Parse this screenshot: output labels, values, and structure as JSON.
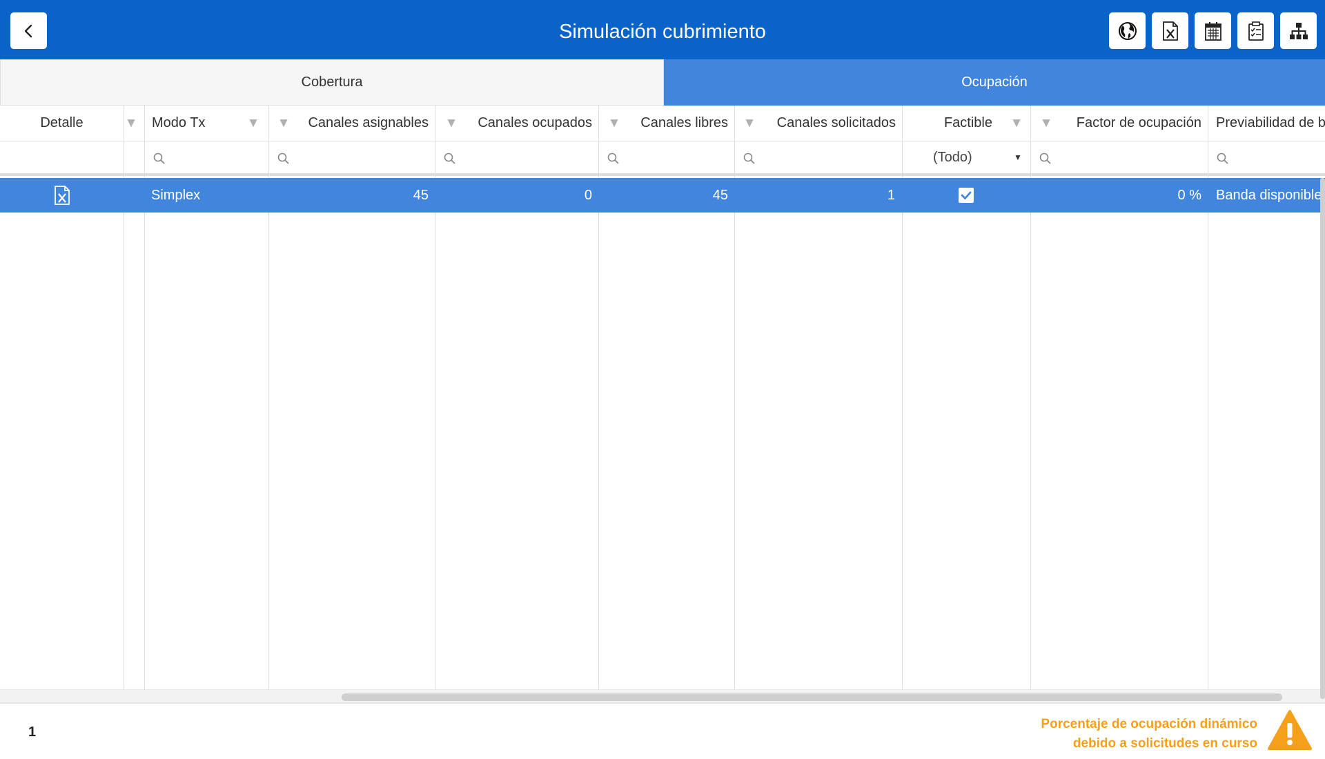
{
  "header": {
    "title": "Simulación cubrimiento",
    "back_icon": "chevron-left-icon",
    "tools": [
      "globe-icon",
      "excel-icon",
      "calendar-icon",
      "clipboard-icon",
      "org-chart-icon"
    ],
    "bg_color": "#0a63c9"
  },
  "tabs": [
    {
      "label": "Cobertura",
      "active": false
    },
    {
      "label": "Ocupación",
      "active": true
    }
  ],
  "grid": {
    "columns": [
      "Detalle",
      "Modo Tx",
      "Canales asignables",
      "Canales ocupados",
      "Canales libres",
      "Canales solicitados",
      "Factible",
      "Factor de ocupación",
      "Previabilidad de b"
    ],
    "factible_filter": "(Todo)",
    "rows": [
      {
        "detalle_icon": "excel-icon",
        "modo_tx": "Simplex",
        "canales_asignables": "45",
        "canales_ocupados": "0",
        "canales_libres": "45",
        "canales_solicitados": "1",
        "factible": true,
        "factor_ocupacion": "0 %",
        "previabilidad": "Banda disponible"
      }
    ],
    "selected_row_color": "#4285dc"
  },
  "footer": {
    "page": "1",
    "warning_line1": "Porcentaje de ocupación dinámico",
    "warning_line2": "debido a solicitudes en curso",
    "warning_color": "#f5a01a"
  }
}
